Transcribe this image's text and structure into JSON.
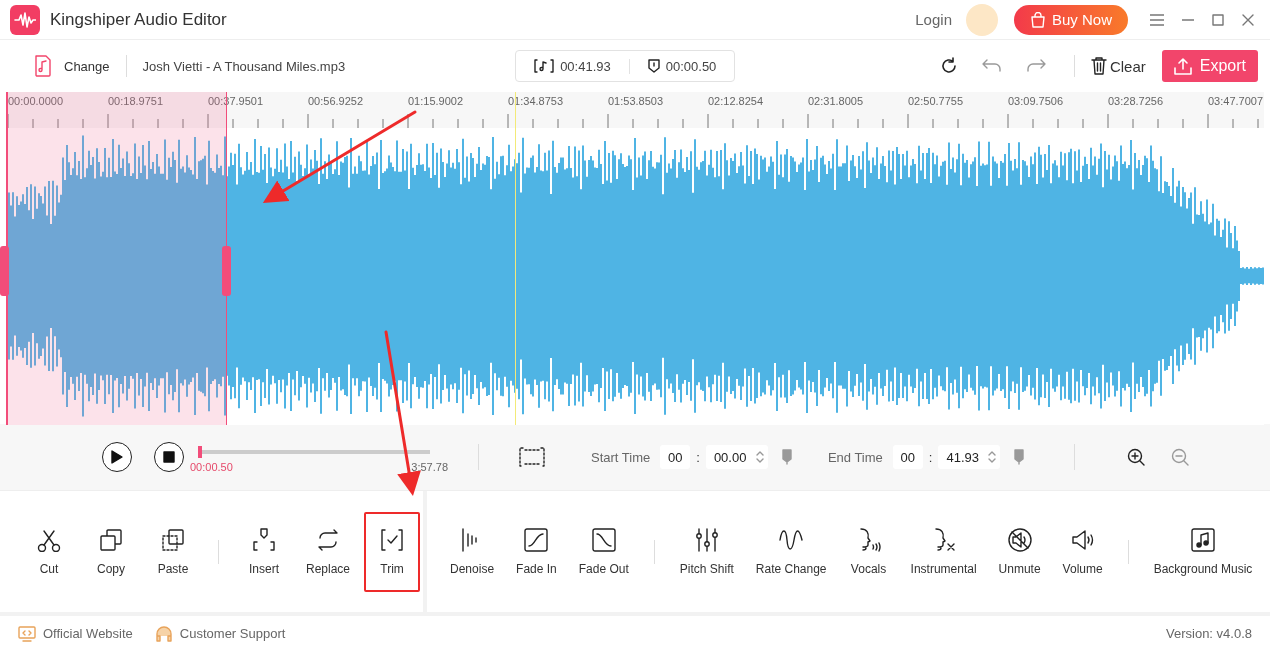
{
  "window": {
    "title": "Kingshiper Audio Editor",
    "login": "Login",
    "buy_button": "Buy Now"
  },
  "toolbar": {
    "change": "Change",
    "file_name": "Josh Vietti - A Thousand Miles.mp3",
    "selection_length": "00:41.93",
    "cursor_time": "00:00.50",
    "clear": "Clear",
    "export": "Export"
  },
  "ruler": {
    "labels": [
      "00:00.0000",
      "00:18.9751",
      "00:37.9501",
      "00:56.9252",
      "01:15.9002",
      "01:34.8753",
      "01:53.8503",
      "02:12.8254",
      "02:31.8005",
      "02:50.7755",
      "03:09.7506",
      "03:28.7256",
      "03:47.7007"
    ]
  },
  "waveform": {
    "selection": {
      "level": 0.176
    },
    "playhead": {
      "level": 0.4
    }
  },
  "playback": {
    "progress": {
      "level": 0.0
    },
    "current_time": "00:00.50",
    "total_time": "3:57.78",
    "start_label": "Start Time",
    "start_min": "00",
    "start_sep": ":",
    "start_sec": "00.00",
    "end_label": "End Time",
    "end_min": "00",
    "end_sep": ":",
    "end_sec": "41.93"
  },
  "tool_panels": [
    {
      "groups": [
        [
          {
            "label": "Cut",
            "highlighted": false
          },
          {
            "label": "Copy",
            "highlighted": false
          },
          {
            "label": "Paste",
            "highlighted": false
          }
        ],
        [
          {
            "label": "Insert",
            "highlighted": false
          },
          {
            "label": "Replace",
            "highlighted": false
          },
          {
            "label": "Trim",
            "highlighted": true
          }
        ]
      ]
    },
    {
      "groups": [
        [
          {
            "label": "Denoise",
            "highlighted": false
          },
          {
            "label": "Fade In",
            "highlighted": false
          },
          {
            "label": "Fade Out",
            "highlighted": false
          }
        ],
        [
          {
            "label": "Pitch Shift",
            "highlighted": false
          },
          {
            "label": "Rate Change",
            "highlighted": false
          },
          {
            "label": "Vocals",
            "highlighted": false
          },
          {
            "label": "Instrumental",
            "highlighted": false
          },
          {
            "label": "Unmute",
            "highlighted": false
          },
          {
            "label": "Volume",
            "highlighted": false
          }
        ],
        [
          {
            "label": "Background Music",
            "highlighted": false
          }
        ]
      ]
    }
  ],
  "status_bar": {
    "links": [
      "Official Website",
      "Customer Support"
    ],
    "version": "Version: v4.0.8"
  }
}
